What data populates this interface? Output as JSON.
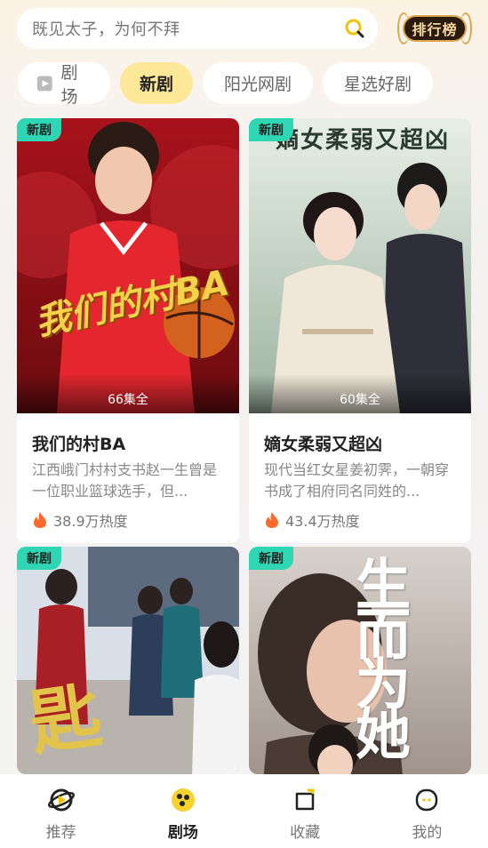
{
  "search": {
    "text": "既见太子，为何不拜"
  },
  "rank_button": {
    "label": "排行榜"
  },
  "tabs": [
    {
      "label": "剧场"
    },
    {
      "label": "新剧",
      "active": true
    },
    {
      "label": "阳光网剧"
    },
    {
      "label": "星选好剧"
    }
  ],
  "cards": [
    {
      "tag": "新剧",
      "episodes": "66集全",
      "title": "我们的村BA",
      "desc": "江西峨门村村支书赵一生曾是一位职业篮球选手，但...",
      "heat": "38.9万热度",
      "poster_text": "我们的村BA"
    },
    {
      "tag": "新剧",
      "episodes": "60集全",
      "title": "嫡女柔弱又超凶",
      "desc": "现代当红女星姜初霁，一朝穿书成了相府同名同姓的...",
      "heat": "43.4万热度",
      "poster_text": "嫡女柔弱又超凶"
    },
    {
      "tag": "新剧",
      "poster_text": "匙"
    },
    {
      "tag": "新剧",
      "poster_text": "生而为她"
    }
  ],
  "bottom_nav": [
    {
      "label": "推荐"
    },
    {
      "label": "剧场",
      "active": true
    },
    {
      "label": "收藏"
    },
    {
      "label": "我的"
    }
  ],
  "colors": {
    "accent_yellow": "#fde899",
    "tag_green": "#2fd6b4",
    "flame": "#ff6a2c"
  }
}
